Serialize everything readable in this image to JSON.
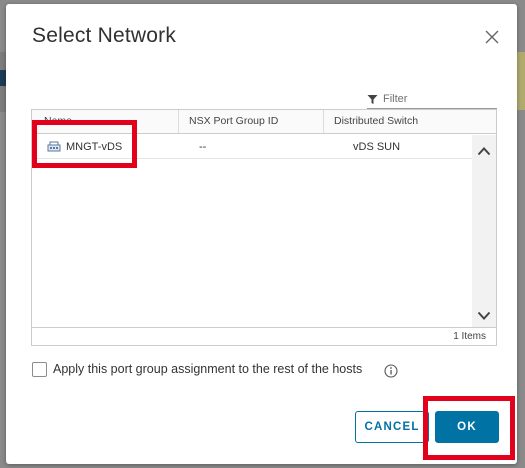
{
  "dialog": {
    "title": "Select Network"
  },
  "filter": {
    "placeholder": "Filter"
  },
  "grid": {
    "columns": [
      "Name",
      "NSX Port Group ID",
      "Distributed Switch"
    ],
    "rows": [
      {
        "name": "MNGT-vDS",
        "nsx_port_group_id": "--",
        "distributed_switch": "vDS SUN"
      }
    ],
    "footer_count": "1 Items"
  },
  "options": {
    "apply_assignment_label": "Apply this port group assignment to the rest of the hosts",
    "apply_assignment_checked": false
  },
  "buttons": {
    "cancel": "CANCEL",
    "ok": "OK"
  },
  "colors": {
    "accent": "#0072a3",
    "highlight": "#e3001b"
  }
}
